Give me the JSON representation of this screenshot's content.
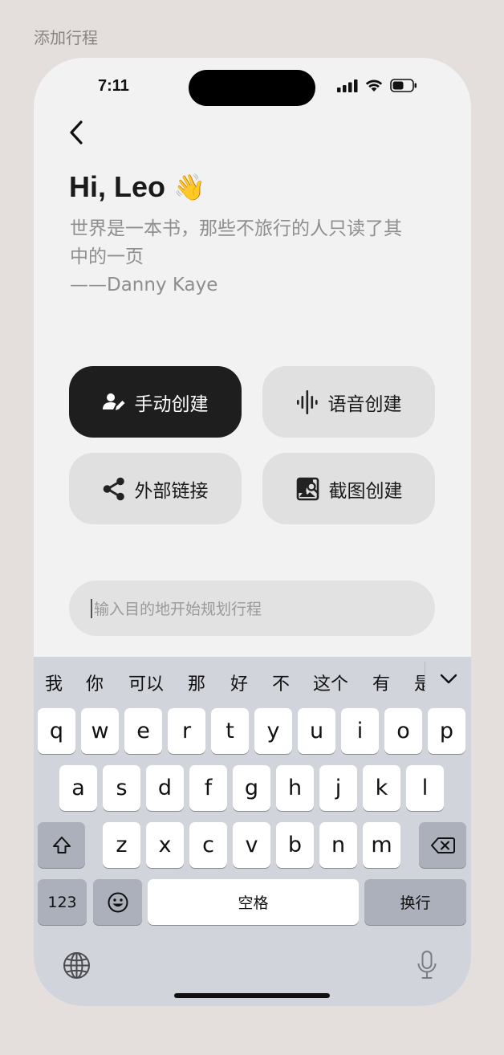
{
  "frame_title": "添加行程",
  "status": {
    "time": "7:11"
  },
  "greeting": {
    "text": "Hi, Leo",
    "emoji": "👋"
  },
  "quote": {
    "line1": "世界是一本书，那些不旅行的人只读了其",
    "line2": "中的一页",
    "author": "——Danny Kaye"
  },
  "actions": {
    "manual": {
      "label": "手动创建",
      "icon": "user-edit-icon"
    },
    "voice": {
      "label": "语音创建",
      "icon": "voice-wave-icon"
    },
    "link": {
      "label": "外部链接",
      "icon": "share-icon"
    },
    "screenshot": {
      "label": "截图创建",
      "icon": "image-search-icon"
    }
  },
  "search": {
    "placeholder": "输入目的地开始规划行程"
  },
  "keyboard": {
    "candidates": [
      "我",
      "你",
      "可以",
      "那",
      "好",
      "不",
      "这个",
      "有",
      "是"
    ],
    "row1": [
      "q",
      "w",
      "e",
      "r",
      "t",
      "y",
      "u",
      "i",
      "o",
      "p"
    ],
    "row2": [
      "a",
      "s",
      "d",
      "f",
      "g",
      "h",
      "j",
      "k",
      "l"
    ],
    "row3": [
      "z",
      "x",
      "c",
      "v",
      "b",
      "n",
      "m"
    ],
    "numbers_label": "123",
    "space_label": "空格",
    "return_label": "换行"
  },
  "colors": {
    "primary_button": "#1e1e1e",
    "secondary_button": "#e0e0e0",
    "background": "#f2f2f2"
  }
}
